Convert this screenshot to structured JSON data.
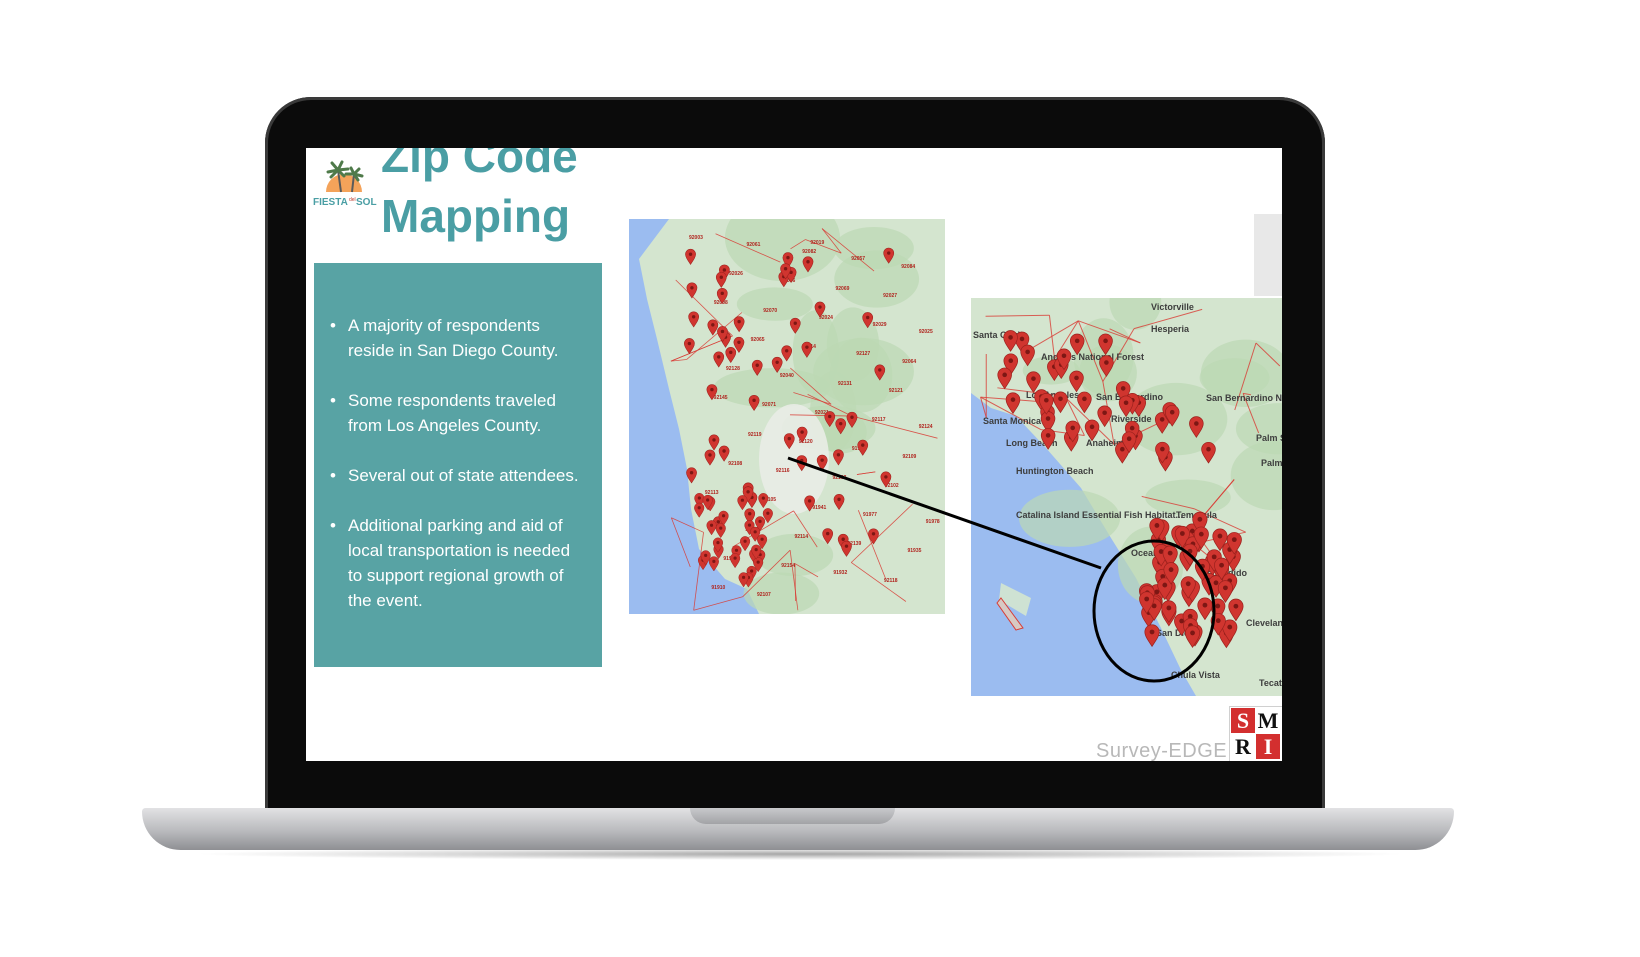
{
  "slide": {
    "title": "Zip Code\nMapping",
    "logo_text": {
      "word1": "FIESTA",
      "word2": "SOL",
      "connector": "del"
    },
    "bullets": [
      "A majority of respondents reside in San Diego County.",
      "Some respondents traveled from Los Angeles County.",
      "Several out of state attendees.",
      "Additional parking and aid of local transportation is needed to support regional growth of the event."
    ],
    "bullet_symbol": "•"
  },
  "map_sd": {
    "zip_labels": [
      "92003",
      "92061",
      "92082",
      "92057",
      "92084",
      "92026",
      "92056",
      "92069",
      "92027",
      "92008",
      "92070",
      "92024",
      "92029",
      "92025",
      "92065",
      "92014",
      "92127",
      "92064",
      "92128",
      "92040",
      "92131",
      "92121",
      "92145",
      "92071",
      "92021",
      "92117",
      "92124",
      "92119",
      "92120",
      "91901",
      "92109",
      "92108",
      "92116",
      "92103",
      "92102",
      "92113",
      "92105",
      "91941",
      "91977",
      "91978",
      "91902",
      "92114",
      "92139",
      "91935",
      "91945",
      "92154",
      "91932",
      "92118",
      "91910",
      "92107",
      "92019"
    ]
  },
  "map_la": {
    "places": [
      "Victorville",
      "Hesperia",
      "Santa Clarita",
      "Angeles National Forest",
      "San Bernardino",
      "Los Angeles",
      "Santa Monica",
      "San Bernardino National Forest",
      "Riverside",
      "Anaheim",
      "Long Beach",
      "Huntington Beach",
      "Palm Springs",
      "Palm Desert",
      "Temecula",
      "Catalina Island Essential Fish Habitat...",
      "Oceanside",
      "Escondido",
      "San Diego",
      "Chula Vista",
      "Tecate",
      "Cleveland National Forest"
    ]
  },
  "footer": {
    "survey_logo": "Survey-EDGE",
    "smri_letters": [
      "S",
      "M",
      "R",
      "I"
    ]
  },
  "colors": {
    "teal_panel": "#58a3a4",
    "title_teal": "#4a9ea4",
    "pin_red": "#d0352f",
    "water": "#9bbcf0",
    "land": "#d4e5cf",
    "boundary": "#d93c35"
  },
  "icons": {
    "pin": "map-pin-icon",
    "logo": "palm-tree-sun-logo",
    "smri": "smri-logo"
  }
}
